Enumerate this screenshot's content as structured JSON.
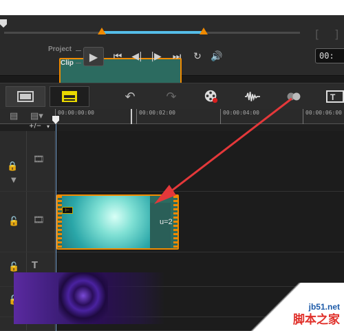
{
  "player": {
    "mode_project": "Project",
    "mode_clip": "Clip",
    "timecode": "00:",
    "selection_start": 0.33,
    "selection_end": 0.67,
    "controls": [
      "play-icon",
      "go-to-start-icon",
      "previous-frame-icon",
      "next-frame-icon",
      "go-to-end-icon",
      "repeat-icon",
      "volume-icon"
    ]
  },
  "toolbar": {
    "buttons": [
      "timeline-view-icon",
      "storyboard-view-icon",
      "undo-icon",
      "redo-icon",
      "record-capture-icon",
      "audio-mixer-icon",
      "auto-music-icon",
      "title-icon"
    ]
  },
  "ruler": {
    "labels": [
      "00:00:00:00",
      "00:00:02:00",
      "00:00:04:00",
      "00:00:06:00"
    ],
    "zoom_label": "+/−"
  },
  "clip": {
    "label": "u=2"
  },
  "colors": {
    "accent_orange": "#f08a00",
    "selection_blue": "#55bde8",
    "annotation_red": "#e4383a"
  },
  "watermark": {
    "site": "jb51.net",
    "name": "脚本之家"
  }
}
